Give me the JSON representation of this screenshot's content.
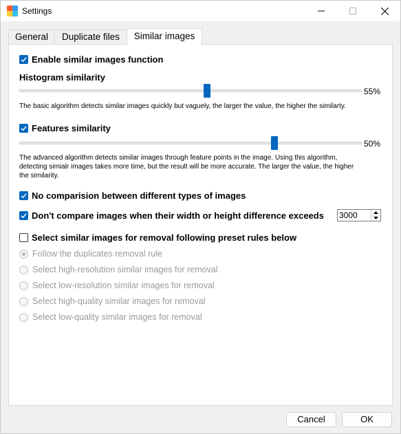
{
  "window": {
    "title": "Settings",
    "app_icon": "app-logo-icon",
    "controls": {
      "minimize": "minimize-icon",
      "maximize": "maximize-icon",
      "close": "close-icon"
    }
  },
  "tabs": [
    {
      "label": "General",
      "active": false
    },
    {
      "label": "Duplicate files",
      "active": false
    },
    {
      "label": "Similar images",
      "active": true
    }
  ],
  "similar": {
    "enable_label": "Enable similar images function",
    "enable_checked": true,
    "histogram_heading": "Histogram similarity",
    "histogram_value": 0.55,
    "histogram_pct": "55%",
    "histogram_desc": "The basic algorithm detects similar images quickly but vaguely, the larger the value, the higher the similarty.",
    "features_label": "Features similarity",
    "features_checked": true,
    "features_value": 0.5,
    "features_pct": "50%",
    "features_desc_1": "The advanced algorithm detects similar images through feature points in the image. Using this algorithm,",
    "features_desc_2": "detecting simialr images takes more time, but the result will be more accurate. The larger the value, the higher",
    "features_desc_3": "the similarity.",
    "no_compare_types_label": "No comparision between different types of images",
    "no_compare_types_checked": true,
    "no_compare_size_label": "Don't compare images when their width or height difference exceeds",
    "no_compare_size_checked": true,
    "size_threshold": "3000",
    "preset_label": "Select similar images for removal following preset rules below",
    "preset_checked": false,
    "rules": [
      {
        "label": "Follow the duplicates removal rule",
        "selected": true
      },
      {
        "label": "Select high-resolution similar images for removal",
        "selected": false
      },
      {
        "label": "Select low-resolution similar images for removal",
        "selected": false
      },
      {
        "label": "Select high-quality similar images for removal",
        "selected": false
      },
      {
        "label": "Select low-quality similar images for removal",
        "selected": false
      }
    ]
  },
  "buttons": {
    "cancel": "Cancel",
    "ok": "OK"
  },
  "colors": {
    "accent": "#0067c0",
    "disabled_text": "#9a9a9a"
  }
}
